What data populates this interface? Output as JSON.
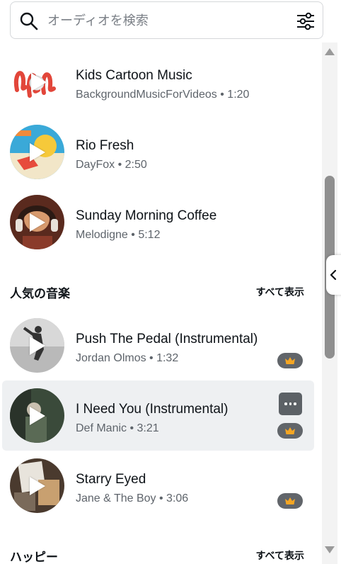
{
  "search": {
    "placeholder": "オーディオを検索"
  },
  "top_tracks": [
    {
      "title": "Kids Cartoon Music",
      "meta": "BackgroundMusicForVideos • 1:20"
    },
    {
      "title": "Rio Fresh",
      "meta": "DayFox • 2:50"
    },
    {
      "title": "Sunday Morning Coffee",
      "meta": "Melodigne • 5:12"
    }
  ],
  "popular": {
    "heading": "人気の音楽",
    "see_all": "すべて表示",
    "tracks": [
      {
        "title": "Push The Pedal (Instrumental)",
        "meta": "Jordan Olmos • 1:32",
        "premium": true
      },
      {
        "title": "I Need You (Instrumental)",
        "meta": "Def Manic • 3:21",
        "premium": true
      },
      {
        "title": "Starry Eyed",
        "meta": "Jane & The Boy • 3:06",
        "premium": true
      }
    ]
  },
  "happy": {
    "heading": "ハッピー",
    "see_all": "すべて表示"
  },
  "icons": {
    "search": "search-icon",
    "filter": "filter-sliders-icon",
    "play": "play-icon",
    "crown": "crown-icon",
    "more": "more-options-icon",
    "collapse": "chevron-left-icon"
  },
  "colors": {
    "crown": "#f5a623",
    "badge_bg": "#61656a",
    "hover_row": "#eef0f2"
  }
}
